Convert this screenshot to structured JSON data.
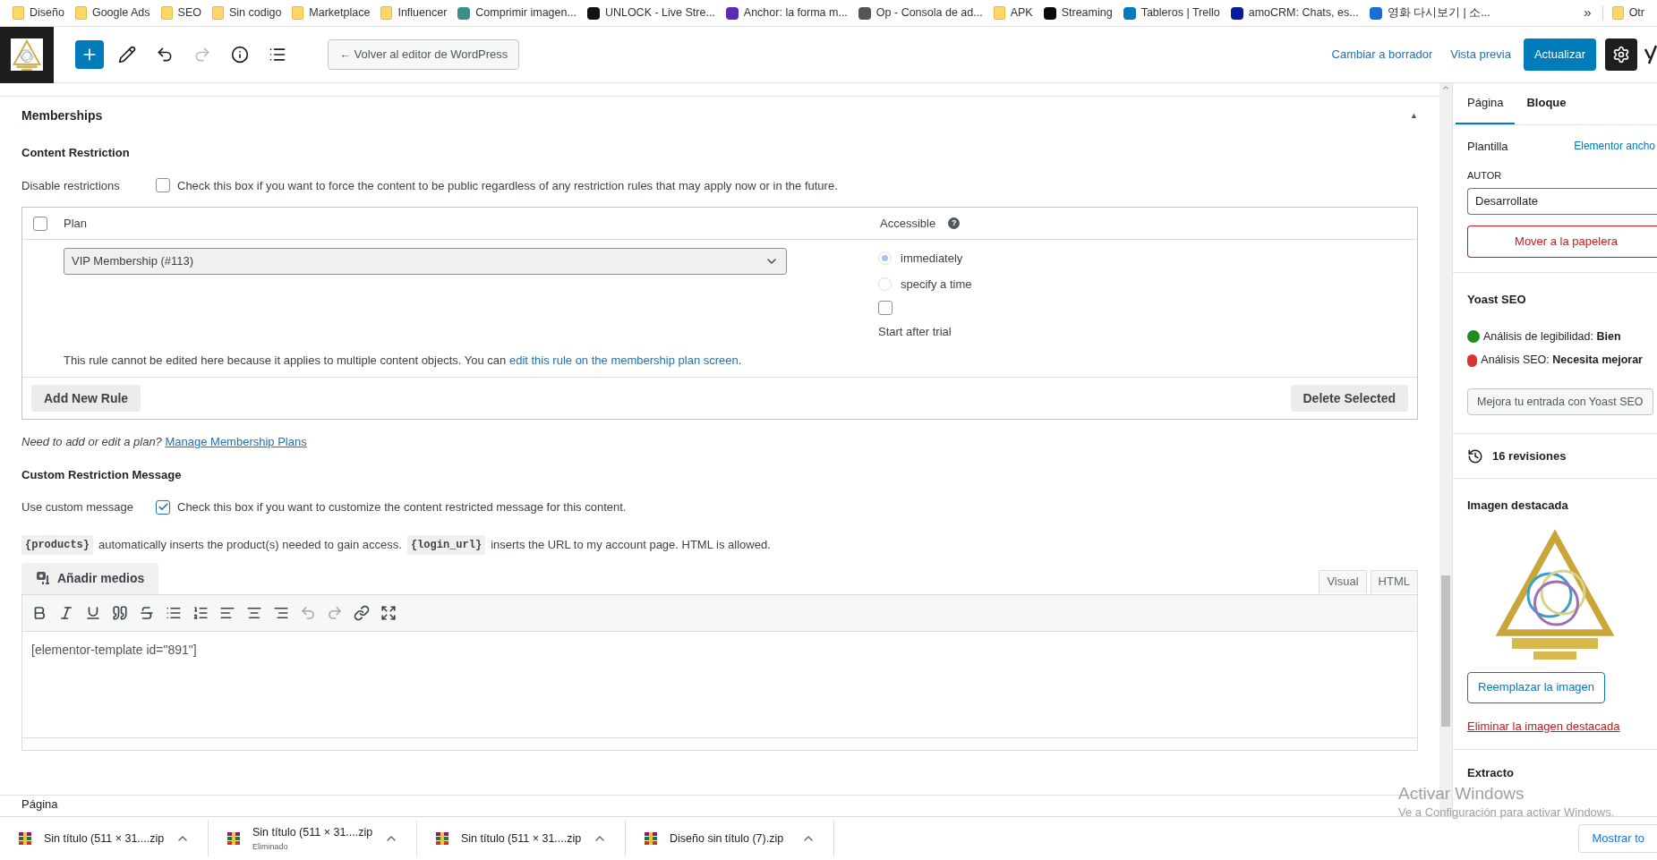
{
  "bookmarks": [
    {
      "kind": "folder",
      "label": "Diseño"
    },
    {
      "kind": "folder",
      "label": "Google Ads"
    },
    {
      "kind": "folder",
      "label": "SEO"
    },
    {
      "kind": "folder",
      "label": "Sin codigo"
    },
    {
      "kind": "folder",
      "label": "Marketplace"
    },
    {
      "kind": "folder",
      "label": "Influencer"
    },
    {
      "kind": "site",
      "label": "Comprimir imagen...",
      "color": "#3a8f8a"
    },
    {
      "kind": "site",
      "label": "UNLOCK - Live Stre...",
      "color": "#111111"
    },
    {
      "kind": "site",
      "label": "Anchor: la forma m...",
      "color": "#5b2bb5"
    },
    {
      "kind": "site",
      "label": "Op - Consola de ad...",
      "color": "#555555"
    },
    {
      "kind": "folder",
      "label": "APK"
    },
    {
      "kind": "site",
      "label": "Streaming",
      "color": "#0a0a0a"
    },
    {
      "kind": "site",
      "label": "Tableros | Trello",
      "color": "#0079bf"
    },
    {
      "kind": "site",
      "label": "amoCRM: Chats, es...",
      "color": "#0a1a9c"
    },
    {
      "kind": "site",
      "label": "영화 다시보기 | 소...",
      "color": "#1a6fd6"
    }
  ],
  "bookmarks_more": "»",
  "bookmarks_other": {
    "kind": "folder",
    "label": "Otr"
  },
  "toolbar": {
    "tools": [
      {
        "kind": "plus",
        "disabled": false
      },
      {
        "kind": "pencil",
        "disabled": false
      },
      {
        "kind": "undo",
        "disabled": false
      },
      {
        "kind": "redo",
        "disabled": true
      },
      {
        "kind": "info",
        "disabled": false
      },
      {
        "kind": "outline",
        "disabled": false
      }
    ],
    "back_button": "← Volver al editor de WordPress",
    "draft_link": "Cambiar a borrador",
    "preview_link": "Vista previa",
    "update_button": "Actualizar"
  },
  "memberships": {
    "title": "Memberships",
    "toggle": "▲",
    "content_restriction": {
      "title": "Content Restriction",
      "disable_label": "Disable restrictions",
      "disable_checked": false,
      "disable_help": "Check this box if you want to force the content to be public regardless of any restriction rules that may apply now or in the future."
    },
    "rules_table": {
      "select_all_checked": false,
      "col_plan": "Plan",
      "col_accessible": "Accessible",
      "help_icon": "?",
      "rule": {
        "plan": "VIP Membership (#113)",
        "options": [
          {
            "label": "immediately",
            "selected": true
          },
          {
            "label": "specify a time",
            "selected": false
          }
        ],
        "trial_checked": false,
        "trial_label": "Start after trial",
        "note": "This rule cannot be edited here because it applies to multiple content objects. You can ",
        "note_link": "edit this rule on the membership plan screen",
        "note_end": "."
      },
      "add_button": "Add New Rule",
      "delete_button": "Delete Selected"
    },
    "plans_note": "Need to add or edit a plan?",
    "plans_link": "Manage Membership Plans",
    "custom_message": {
      "title": "Custom Restriction Message",
      "use_label": "Use custom message",
      "use_checked": true,
      "use_help": "Check this box if you want to customize the content restricted message for this content.",
      "hint": [
        {
          "kind": "code",
          "text": "{products}"
        },
        {
          "kind": "text",
          "text": "automatically inserts the product(s) needed to gain access."
        },
        {
          "kind": "code",
          "text": "{login_url}"
        },
        {
          "kind": "text",
          "text": "inserts the URL to my account page. HTML is allowed."
        }
      ],
      "media_button": "Añadir medios",
      "modes": [
        {
          "label": "Visual",
          "selected": false
        },
        {
          "label": "HTML",
          "selected": false
        }
      ],
      "format_tools": [
        {
          "kind": "bold",
          "disabled": false
        },
        {
          "kind": "italic",
          "disabled": false
        },
        {
          "kind": "underline",
          "disabled": false
        },
        {
          "kind": "quote",
          "disabled": false
        },
        {
          "kind": "strike",
          "disabled": false
        },
        {
          "kind": "bullets",
          "disabled": false
        },
        {
          "kind": "numbers",
          "disabled": false
        },
        {
          "kind": "align-left",
          "disabled": false
        },
        {
          "kind": "align-center",
          "disabled": false
        },
        {
          "kind": "align-right",
          "disabled": false
        },
        {
          "kind": "undo",
          "disabled": true
        },
        {
          "kind": "redo",
          "disabled": true
        },
        {
          "kind": "link",
          "disabled": false
        },
        {
          "kind": "fullscreen",
          "disabled": false
        }
      ],
      "content": "[elementor-template id=\"891\"]"
    }
  },
  "status_bar": "Página",
  "sidebar": {
    "tabs": [
      {
        "label": "Página",
        "selected": true
      },
      {
        "label": "Bloque",
        "selected": false
      }
    ],
    "template_label": "Plantilla",
    "template_value": "Elementor ancho",
    "author_label": "AUTOR",
    "author_value": "Desarrollate",
    "trash_button": "Mover a la papelera",
    "yoast_title": "Yoast SEO",
    "analyses": [
      {
        "text": "Análisis de legibilidad: **Bien**",
        "color": "#1e8c1e"
      },
      {
        "text": "Análisis SEO: **Necesita mejorar**",
        "color": "#dc3232"
      }
    ],
    "yoast_button": "Mejora tu entrada con Yoast SEO",
    "revisions": "16 revisiones",
    "featured_title": "Imagen destacada",
    "replace_button": "Reemplazar la imagen",
    "remove_link": "Eliminar la imagen destacada",
    "excerpt_title": "Extracto"
  },
  "downloads": [
    {
      "name": "Sin título (511 × 31....zip"
    },
    {
      "name": "Sin título (511 × 31....zip",
      "note": "Eliminado"
    },
    {
      "name": "Sin título (511 × 31....zip"
    },
    {
      "name": "Diseño sin título (7).zip"
    }
  ],
  "downloads_show_all": "Mostrar to",
  "os_notice": {
    "title": "Activar Windows",
    "text": "Ve a Configuración para activar Windows."
  }
}
